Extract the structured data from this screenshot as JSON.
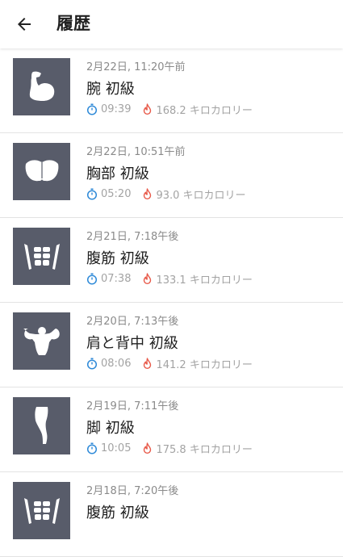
{
  "header": {
    "title": "履歴"
  },
  "items": [
    {
      "date": "2月22日, 11:20午前",
      "name": "腕 初級",
      "duration": "09:39",
      "calories": "168.2 キロカロリー",
      "icon": "arm-muscle-icon"
    },
    {
      "date": "2月22日, 10:51午前",
      "name": "胸部 初級",
      "duration": "05:20",
      "calories": "93.0 キロカロリー",
      "icon": "chest-icon"
    },
    {
      "date": "2月21日, 7:18午後",
      "name": "腹筋 初級",
      "duration": "07:38",
      "calories": "133.1 キロカロリー",
      "icon": "abs-icon"
    },
    {
      "date": "2月20日, 7:13午後",
      "name": "肩と背中 初級",
      "duration": "08:06",
      "calories": "141.2 キロカロリー",
      "icon": "shoulder-back-icon"
    },
    {
      "date": "2月19日, 7:11午後",
      "name": "脚 初級",
      "duration": "10:05",
      "calories": "175.8 キロカロリー",
      "icon": "leg-icon"
    },
    {
      "date": "2月18日, 7:20午後",
      "name": "腹筋 初級",
      "duration": "",
      "calories": "",
      "icon": "abs-icon"
    }
  ],
  "colors": {
    "thumb_bg": "#585c6a",
    "timer_icon": "#2f8ad8",
    "fire_icon": "#e85a4a"
  }
}
